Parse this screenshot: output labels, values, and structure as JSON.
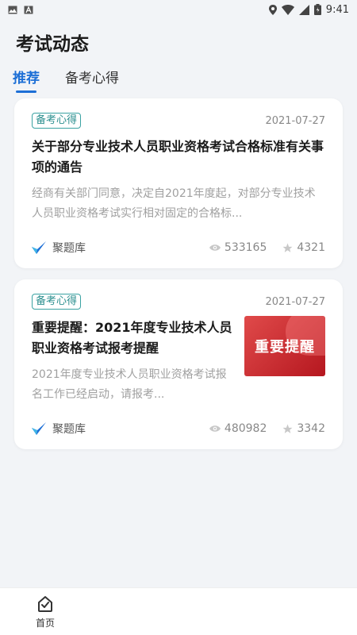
{
  "status_bar": {
    "time": "9:41",
    "icons": [
      "image-icon",
      "a-box-icon",
      "location-icon",
      "wifi-icon",
      "signal-icon",
      "battery-icon"
    ]
  },
  "page": {
    "title": "考试动态"
  },
  "tabs": [
    {
      "label": "推荐",
      "active": true
    },
    {
      "label": "备考心得",
      "active": false
    }
  ],
  "cards": [
    {
      "tag": "备考心得",
      "date": "2021-07-27",
      "title": "关于部分专业技术人员职业资格考试合格标准有关事项的通告",
      "desc": "经商有关部门同意，决定自2021年度起，对部分专业技术人员职业资格考试实行相对固定的合格标...",
      "brand": "聚题库",
      "views": "533165",
      "stars": "4321"
    },
    {
      "tag": "备考心得",
      "date": "2021-07-27",
      "title": "重要提醒：2021年度专业技术人员职业资格考试报考提醒",
      "desc": "2021年度专业技术人员职业资格考试报名工作已经启动，请报考...",
      "thumb_text": "重要提醒",
      "brand": "聚题库",
      "views": "480982",
      "stars": "3342"
    }
  ],
  "bottom_nav": [
    {
      "label": "首页",
      "icon": "home-check-icon"
    }
  ],
  "colors": {
    "accent": "#1d6fd6",
    "tag": "#2c8f8f",
    "thumb": "#d32f2f"
  }
}
